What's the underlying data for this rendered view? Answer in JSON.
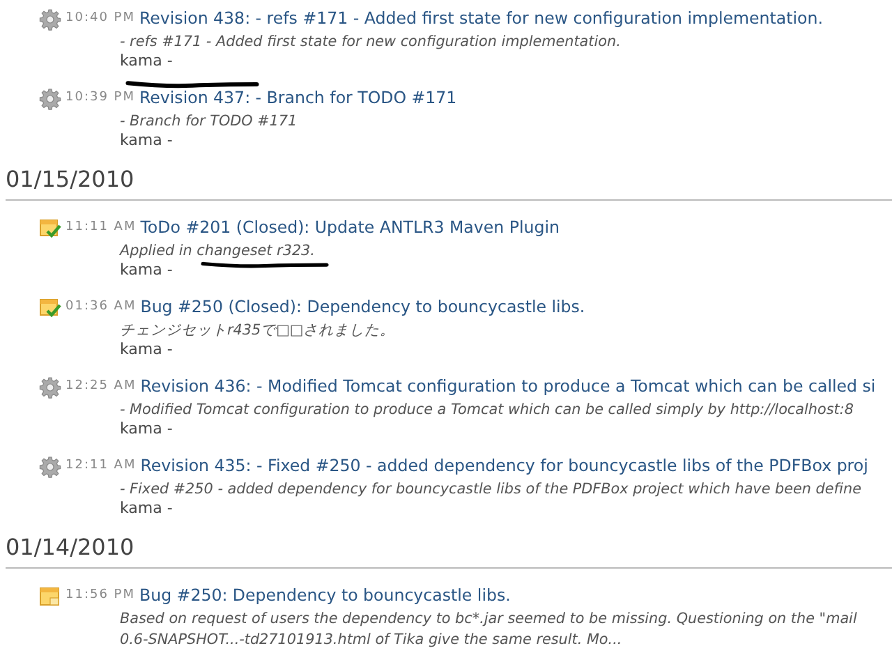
{
  "groups": [
    {
      "entries": [
        {
          "kind": "changeset",
          "time": "10:40 PM",
          "title": "Revision 438: - refs #171 - Added first state for new configuration implementation.",
          "description": [
            "- refs #171 - Added first state for new configuration implementation."
          ],
          "author": "kama -",
          "author_scribbled": true
        },
        {
          "kind": "changeset",
          "time": "10:39 PM",
          "title": "Revision 437: - Branch for TODO #171",
          "description": [
            "- Branch for TODO #171"
          ],
          "author": "kama -"
        }
      ]
    },
    {
      "date": "01/15/2010",
      "entries": [
        {
          "kind": "issue-closed",
          "time": "11:11 AM",
          "title": "ToDo #201 (Closed): Update ANTLR3 Maven Plugin",
          "description": [
            "Applied in changeset r323."
          ],
          "author": "kama -",
          "description_scribbled": true
        },
        {
          "kind": "issue-closed",
          "time": "01:36 AM",
          "title": "Bug #250 (Closed): Dependency to bouncycastle libs.",
          "description": [
            "チェンジセットr435で□□されました。"
          ],
          "author": "kama -"
        },
        {
          "kind": "changeset",
          "time": "12:25 AM",
          "title": "Revision 436: - Modified Tomcat configuration to produce a Tomcat which can be called si",
          "description": [
            "- Modified Tomcat configuration to produce a Tomcat which can be called simply by http://localhost:8"
          ],
          "author": "kama -"
        },
        {
          "kind": "changeset",
          "time": "12:11 AM",
          "title": "Revision 435: - Fixed #250 - added dependency for bouncycastle libs of the PDFBox proj",
          "description": [
            "- Fixed #250 - added dependency for bouncycastle libs of the PDFBox project which have been define"
          ],
          "author": "kama -"
        }
      ]
    },
    {
      "date": "01/14/2010",
      "entries": [
        {
          "kind": "issue",
          "time": "11:56 PM",
          "title": "Bug #250: Dependency to bouncycastle libs.",
          "description": [
            "Based on request of users the dependency to bc*.jar seemed to be missing. Questioning on the \"mail",
            "0.6-SNAPSHOT...-td27101913.html of Tika give the same result. Mo..."
          ]
        }
      ]
    }
  ]
}
